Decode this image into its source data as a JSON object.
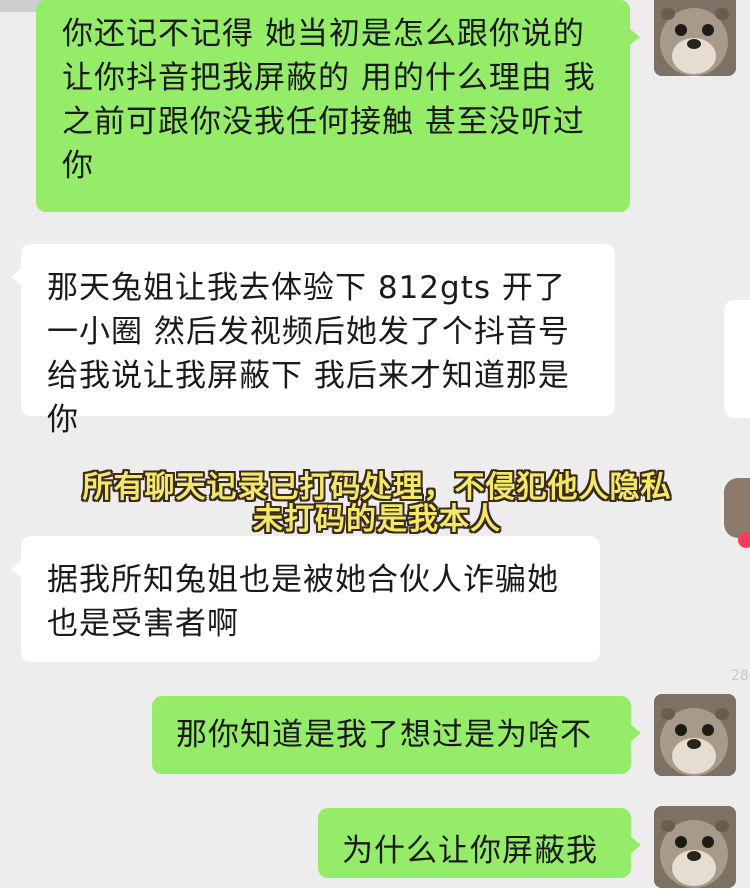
{
  "messages": [
    {
      "side": "sent",
      "text": "你还记不记得 她当初是怎么跟你说的 让你抖音把我屏蔽的 用的什么理由 我之前可跟你没我任何接触 甚至没听过你"
    },
    {
      "side": "recv",
      "text": "那天兔姐让我去体验下 812gts 开了一小圈 然后发视频后她发了个抖音号给我说让我屏蔽下 我后来才知道那是你"
    },
    {
      "side": "recv",
      "text": "据我所知兔姐也是被她合伙人诈骗她也是受害者啊"
    },
    {
      "side": "sent",
      "text": "那你知道是我了想过是为啥不"
    },
    {
      "side": "sent",
      "text": "为什么让你屏蔽我"
    }
  ],
  "overlay": {
    "line1": "所有聊天记录已打码处理，不侵犯他人隐私",
    "line2": "未打码的是我本人"
  },
  "side_label": "28",
  "avatar_icon": "otter-avatar-icon",
  "colors": {
    "background": "#ededed",
    "sent_bubble": "#95ec69",
    "recv_bubble": "#ffffff",
    "caption_text": "#f3e86a"
  }
}
